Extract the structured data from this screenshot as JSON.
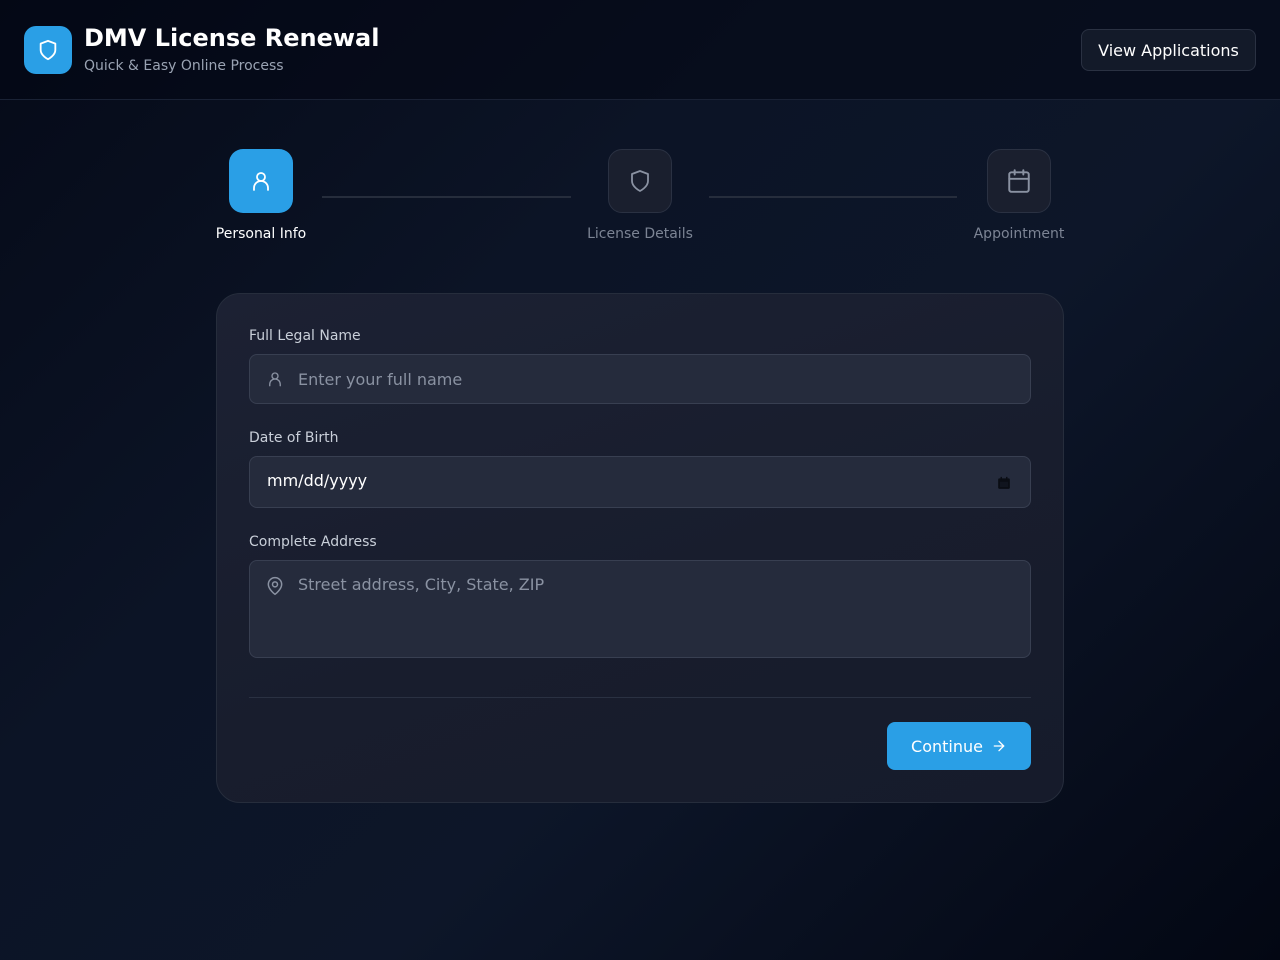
{
  "header": {
    "title": "DMV License Renewal",
    "subtitle": "Quick & Easy Online Process",
    "view_applications_label": "View Applications",
    "logo_icon": "shield-icon"
  },
  "steps": [
    {
      "label": "Personal Info",
      "icon": "user-icon",
      "state": "active"
    },
    {
      "label": "License Details",
      "icon": "shield-icon",
      "state": "inactive"
    },
    {
      "label": "Appointment",
      "icon": "calendar-icon",
      "state": "inactive"
    }
  ],
  "form": {
    "full_name": {
      "label": "Full Legal Name",
      "placeholder": "Enter your full name",
      "value": "",
      "icon": "user-icon"
    },
    "dob": {
      "label": "Date of Birth",
      "display_value": "mm/dd/yyyy",
      "icon": "calendar-icon"
    },
    "address": {
      "label": "Complete Address",
      "placeholder": "Street address, City, State, ZIP",
      "value": "",
      "icon": "map-pin-icon"
    },
    "continue_label": "Continue",
    "continue_icon": "arrow-right-icon"
  },
  "colors": {
    "accent": "#2a9fe6",
    "background": "#0c1426",
    "card": "#1a1f2f",
    "input": "#252b3c",
    "muted_text": "#7c8494"
  }
}
